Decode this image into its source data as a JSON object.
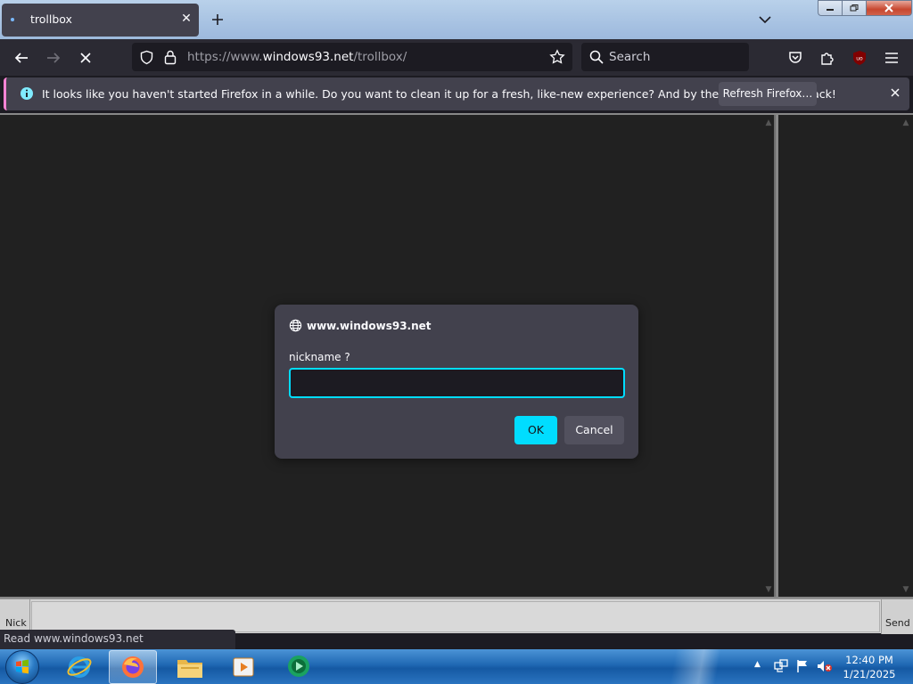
{
  "browser": {
    "tab_title": "trollbox",
    "url_prefix": "https://www.",
    "url_host": "windows93.net",
    "url_path": "/trollbox/",
    "search_placeholder": "Search"
  },
  "notification": {
    "message": "It looks like you haven't started Firefox in a while. Do you want to clean it up for a fresh, like-new experience? And by the way, welcome back!",
    "refresh_label": "Refresh Firefox…"
  },
  "page": {
    "nick_label": "Nick",
    "send_label": "Send",
    "status_text": "Read www.windows93.net"
  },
  "dialog": {
    "origin": "www.windows93.net",
    "prompt": "nickname ?",
    "input_value": "",
    "ok_label": "OK",
    "cancel_label": "Cancel"
  },
  "taskbar": {
    "time": "12:40 PM",
    "date": "1/21/2025",
    "pinned": [
      "internet-explorer-icon",
      "firefox-icon",
      "file-explorer-icon",
      "media-player-icon",
      "chat-app-icon"
    ]
  },
  "colors": {
    "accent": "#00ddff",
    "dialog_bg": "#42414d",
    "toolbar_bg": "#2b2a33",
    "page_bg": "#212121"
  }
}
